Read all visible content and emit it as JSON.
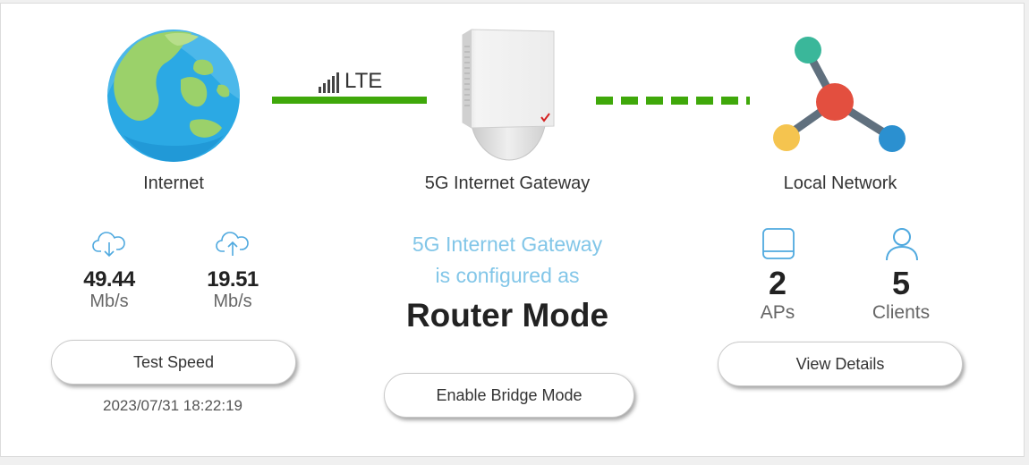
{
  "connection": {
    "type": "LTE",
    "line_color": "#3fa80a"
  },
  "nodes": {
    "internet": "Internet",
    "gateway": "5G Internet Gateway",
    "local": "Local Network"
  },
  "speeds": {
    "download": {
      "value": "49.44",
      "unit": "Mb/s",
      "icon": "cloud-download-icon"
    },
    "upload": {
      "value": "19.51",
      "unit": "Mb/s",
      "icon": "cloud-upload-icon"
    }
  },
  "test_speed_button": "Test Speed",
  "last_test": "2023/07/31 18:22:19",
  "mode": {
    "line1": "5G Internet Gateway",
    "line2": "is configured as",
    "value": "Router Mode",
    "accent_color": "#82c6e8"
  },
  "bridge_button": "Enable Bridge Mode",
  "local_stats": {
    "aps": {
      "count": "2",
      "label": "APs",
      "icon": "access-point-icon"
    },
    "clients": {
      "count": "5",
      "label": "Clients",
      "icon": "user-icon"
    }
  },
  "view_details_button": "View Details"
}
